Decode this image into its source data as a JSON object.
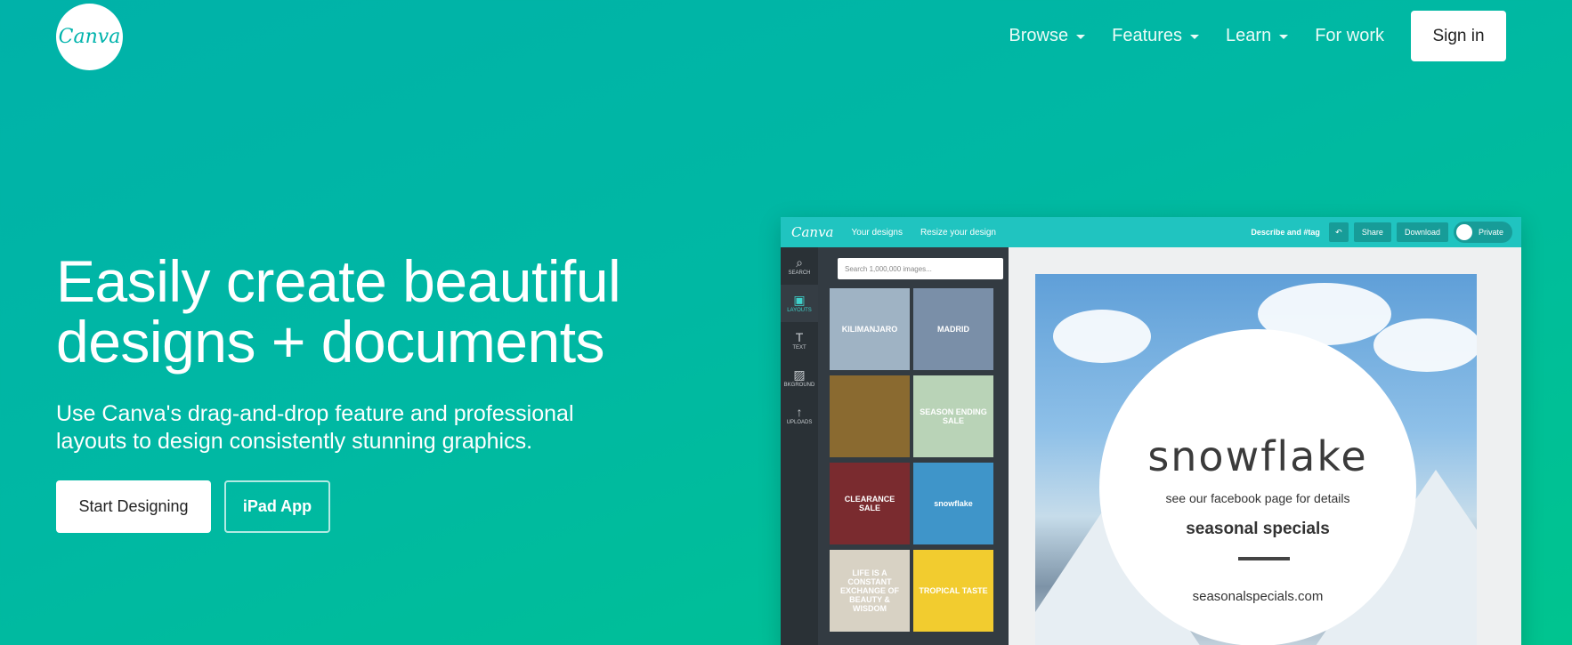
{
  "header": {
    "logo_text": "Canva",
    "nav": [
      {
        "label": "Browse",
        "dropdown": true
      },
      {
        "label": "Features",
        "dropdown": true
      },
      {
        "label": "Learn",
        "dropdown": true
      },
      {
        "label": "For work",
        "dropdown": false
      }
    ],
    "sign_in": "Sign in"
  },
  "hero": {
    "title_line1": "Easily create beautiful",
    "title_line2": "designs + documents",
    "subtitle_line1": "Use Canva's drag-and-drop feature and professional",
    "subtitle_line2": "layouts to design consistently stunning graphics.",
    "start_button": "Start Designing",
    "ipad_button": "iPad App"
  },
  "mockup": {
    "logo": "Canva",
    "links": [
      "Your designs",
      "Resize your design"
    ],
    "tag_label": "Describe and #tag",
    "share": "Share",
    "download": "Download",
    "private": "Private",
    "sidebar": [
      {
        "label": "SEARCH",
        "icon": "search-icon"
      },
      {
        "label": "LAYOUTS",
        "icon": "layouts-icon"
      },
      {
        "label": "TEXT",
        "icon": "text-icon"
      },
      {
        "label": "BKGROUND",
        "icon": "background-icon"
      },
      {
        "label": "UPLOADS",
        "icon": "upload-icon"
      }
    ],
    "search_placeholder": "Search 1,000,000 images...",
    "thumbnails": [
      {
        "text": "KILIMANJARO",
        "bg": "#9fb3c4"
      },
      {
        "text": "MADRID",
        "bg": "#7a8fa8"
      },
      {
        "text": "",
        "bg": "#8a6a30"
      },
      {
        "text": "SEASON ENDING SALE",
        "bg": "#b9d3b7"
      },
      {
        "text": "CLEARANCE SALE",
        "bg": "#7a2b2f"
      },
      {
        "text": "snowflake",
        "bg": "#3f95c9"
      },
      {
        "text": "LIFE IS A CONSTANT EXCHANGE OF BEAUTY & WISDOM",
        "bg": "#d8d2c4"
      },
      {
        "text": "TROPICAL TASTE",
        "bg": "#f2cc2f"
      }
    ],
    "canvas": {
      "title": "snowflake",
      "subtitle": "see our facebook page for details",
      "specials": "seasonal specials",
      "site": "seasonalspecials.com"
    }
  }
}
